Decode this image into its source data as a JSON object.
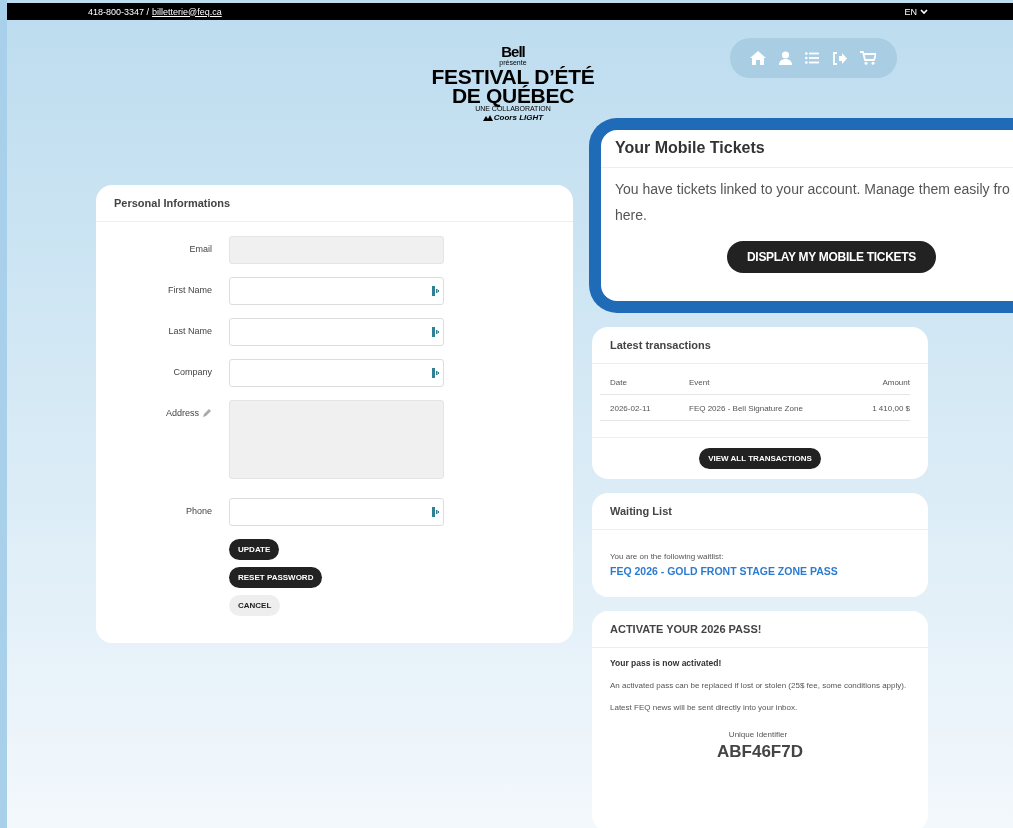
{
  "top_bar": {
    "phone": "418-800-3347 /",
    "email": "billetterie@feq.ca",
    "language": "EN"
  },
  "logo": {
    "sponsor": "Bell",
    "presents": "présente",
    "line_1": "FESTIVAL D’ÉTÉ",
    "line_2": "DE QUÉBEC",
    "collab": "UNE COLLABORATION",
    "partner": "Coors LIGHT"
  },
  "nav": [
    {
      "kind": "home"
    },
    {
      "kind": "account"
    },
    {
      "kind": "list"
    },
    {
      "kind": "logout"
    },
    {
      "kind": "cart"
    }
  ],
  "personal": {
    "title": "Personal Informations",
    "fields": [
      {
        "label": "Email",
        "kind": "input",
        "disabled": true,
        "autofill": false
      },
      {
        "label": "First Name",
        "kind": "input",
        "disabled": false,
        "autofill": true
      },
      {
        "label": "Last Name",
        "kind": "input",
        "disabled": false,
        "autofill": true
      },
      {
        "label": "Company",
        "kind": "input",
        "disabled": false,
        "autofill": true
      },
      {
        "label": "Address",
        "kind": "textarea",
        "disabled": true
      },
      {
        "label": "Phone",
        "kind": "input",
        "disabled": false,
        "autofill": true
      }
    ],
    "buttons": [
      {
        "label": "UPDATE",
        "kind": "primary"
      },
      {
        "label": "RESET PASSWORD",
        "kind": "primary"
      },
      {
        "label": "CANCEL",
        "kind": "secondary"
      }
    ]
  },
  "mobile_tickets": {
    "title": "Your Mobile Tickets",
    "text_1": "You have tickets linked to your account. Manage them easily fro",
    "text_2": "here.",
    "button": "DISPLAY MY MOBILE TICKETS"
  },
  "transactions": {
    "title": "Latest transactions",
    "columns": [
      "Date",
      "Event",
      "Amount"
    ],
    "rows": [
      {
        "date": "2026-02-11",
        "event": "FEQ 2026 - Bell Signature Zone",
        "amount": "1 410,00 $"
      }
    ],
    "button": "VIEW ALL TRANSACTIONS"
  },
  "waiting_list": {
    "title": "Waiting List",
    "text": "You are on the following waitlist:",
    "item": "FEQ 2026 - GOLD FRONT STAGE ZONE PASS"
  },
  "pass": {
    "title": "ACTIVATE YOUR 2026 PASS!",
    "status": "Your pass is now activated!",
    "text_1": "An activated pass can be replaced if lost or stolen (25$ fee, some conditions apply).",
    "text_2": "Latest FEQ news will be sent directly into your inbox.",
    "id_label": "Unique Identifier",
    "id": "ABF46F7D"
  }
}
